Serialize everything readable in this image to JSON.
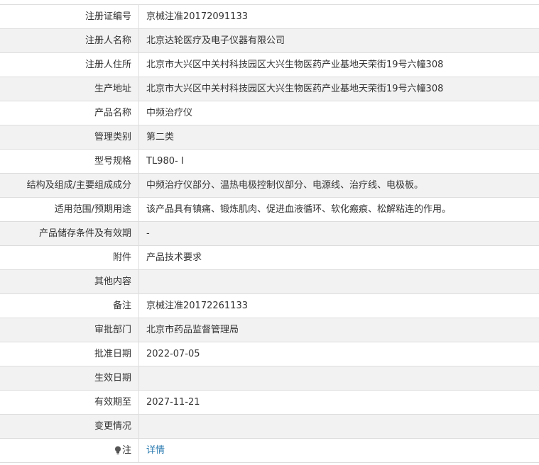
{
  "rows": [
    {
      "label": "注册证编号",
      "value": "京械注准20172091133"
    },
    {
      "label": "注册人名称",
      "value": "北京达轮医疗及电子仪器有限公司"
    },
    {
      "label": "注册人住所",
      "value": "北京市大兴区中关村科技园区大兴生物医药产业基地天荣街19号六幢308"
    },
    {
      "label": "生产地址",
      "value": "北京市大兴区中关村科技园区大兴生物医药产业基地天荣街19号六幢308"
    },
    {
      "label": "产品名称",
      "value": "中频治疗仪"
    },
    {
      "label": "管理类别",
      "value": "第二类"
    },
    {
      "label": "型号规格",
      "value": "TL980- Ⅰ"
    },
    {
      "label": "结构及组成/主要组成成分",
      "value": "中频治疗仪部分、温热电极控制仪部分、电源线、治疗线、电极板。"
    },
    {
      "label": "适用范围/预期用途",
      "value": "该产品具有镇痛、锻炼肌肉、促进血液循环、软化瘢痕、松解粘连的作用。"
    },
    {
      "label": "产品储存条件及有效期",
      "value": "-"
    },
    {
      "label": "附件",
      "value": "产品技术要求"
    },
    {
      "label": "其他内容",
      "value": ""
    },
    {
      "label": "备注",
      "value": "京械注准20172261133"
    },
    {
      "label": "审批部门",
      "value": "北京市药品监督管理局"
    },
    {
      "label": "批准日期",
      "value": "2022-07-05"
    },
    {
      "label": "生效日期",
      "value": ""
    },
    {
      "label": "有效期至",
      "value": "2027-11-21"
    },
    {
      "label": "变更情况",
      "value": ""
    }
  ],
  "note": {
    "label": "注",
    "icon": "lightbulb-icon",
    "link_text": "详情"
  },
  "colors": {
    "shaded_row": "#f2f2f2",
    "border": "#dddddd",
    "link": "#2a7ab0"
  }
}
